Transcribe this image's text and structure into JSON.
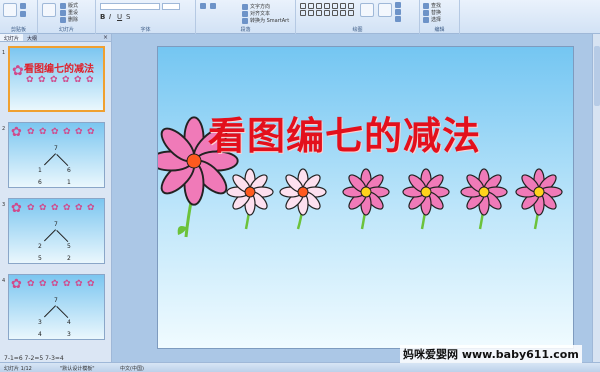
{
  "ribbon": {
    "groups": [
      "剪贴板",
      "幻灯片",
      "字体",
      "段落",
      "绘图",
      "编辑"
    ],
    "paste_label": "粘贴",
    "new_slide_label": "新建\n幻灯片",
    "layout_label": "版式",
    "reset_label": "重设",
    "delete_label": "删除",
    "text_direction_label": "文字方向",
    "align_text_label": "对齐文本",
    "smartart_label": "转换为 SmartArt",
    "arrange_label": "排列",
    "quick_styles_label": "快速样式",
    "shape_fill_label": "形状填充",
    "shape_outline_label": "形状轮廓",
    "shape_effects_label": "形状效果",
    "find_label": "查找",
    "replace_label": "替换",
    "select_label": "选择"
  },
  "panel": {
    "tabs": [
      "幻灯片",
      "大纲"
    ],
    "close": "×",
    "thumbs": [
      {
        "number": "1",
        "title": "看图编七的减法"
      },
      {
        "number": "2",
        "top": "7",
        "left": "1",
        "right": "6",
        "bottom_left": "6",
        "bottom_right": "1"
      },
      {
        "number": "3",
        "top": "7",
        "left": "2",
        "right": "5",
        "bottom_left": "5",
        "bottom_right": "2"
      },
      {
        "number": "4",
        "top": "7",
        "left": "3",
        "right": "4",
        "bottom_left": "4",
        "bottom_right": "3"
      }
    ],
    "footer_text": "7-1=6  7-2=5  7-3=4"
  },
  "slide": {
    "title": "看图编七的减法",
    "flower_count": 7
  },
  "status": {
    "slide_info": "幻灯片 1/12",
    "theme": "\"默认设计模板\"",
    "language": "中文(中国)"
  },
  "watermark": "妈咪爱婴网 www.baby611.com",
  "colors": {
    "title": "#e3101c",
    "petal_pink": "#f07ab8",
    "center_orange": "#ff5a1f",
    "center_yellow": "#ffd21c",
    "stem": "#6cc23a"
  }
}
